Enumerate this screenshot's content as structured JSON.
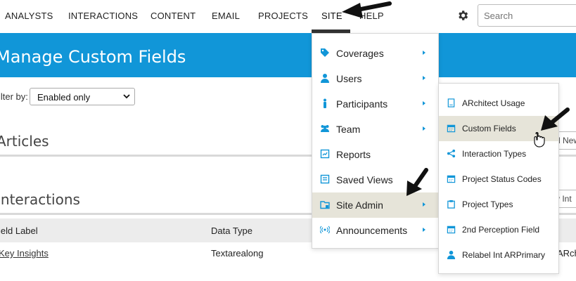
{
  "nav": {
    "items": [
      "ANALYSTS",
      "INTERACTIONS",
      "CONTENT",
      "EMAIL",
      "PROJECTS",
      "SITE",
      "HELP"
    ],
    "active": "SITE",
    "search_placeholder": "Search"
  },
  "colors": {
    "brand_blue": "#1196d8",
    "highlight": "#e6e4d9"
  },
  "header": {
    "title": "Manage Custom Fields"
  },
  "filter": {
    "label": "ilter by:",
    "value": "Enabled only"
  },
  "sections": {
    "articles": "Articles",
    "interactions": "Interactions"
  },
  "table": {
    "headers": [
      "ield Label",
      "Data Type"
    ],
    "row": {
      "label": "Key Insights",
      "type": "Textarealong",
      "right": "ARch"
    }
  },
  "right_buttons": {
    "articles": "d New",
    "interactions": "v Int"
  },
  "site_menu": {
    "items": [
      {
        "label": "Coverages",
        "icon": "tag-icon"
      },
      {
        "label": "Users",
        "icon": "user-icon"
      },
      {
        "label": "Participants",
        "icon": "person-icon"
      },
      {
        "label": "Team",
        "icon": "team-icon"
      },
      {
        "label": "Reports",
        "icon": "report-icon"
      },
      {
        "label": "Saved Views",
        "icon": "saved-views-icon"
      },
      {
        "label": "Site Admin",
        "icon": "site-admin-icon"
      },
      {
        "label": "Announcements",
        "icon": "broadcast-icon"
      }
    ],
    "highlighted": "Site Admin"
  },
  "site_admin_submenu": {
    "items": [
      {
        "label": "ARchitect Usage",
        "icon": "document-icon"
      },
      {
        "label": "Custom Fields",
        "icon": "calendar-icon"
      },
      {
        "label": "Interaction Types",
        "icon": "share-icon"
      },
      {
        "label": "Project Status Codes",
        "icon": "calendar-icon"
      },
      {
        "label": "Project Types",
        "icon": "clipboard-icon"
      },
      {
        "label": "2nd Perception Field",
        "icon": "calendar-icon"
      },
      {
        "label": "Relabel Int ARPrimary",
        "icon": "user-icon"
      }
    ],
    "highlighted": "Custom Fields"
  }
}
